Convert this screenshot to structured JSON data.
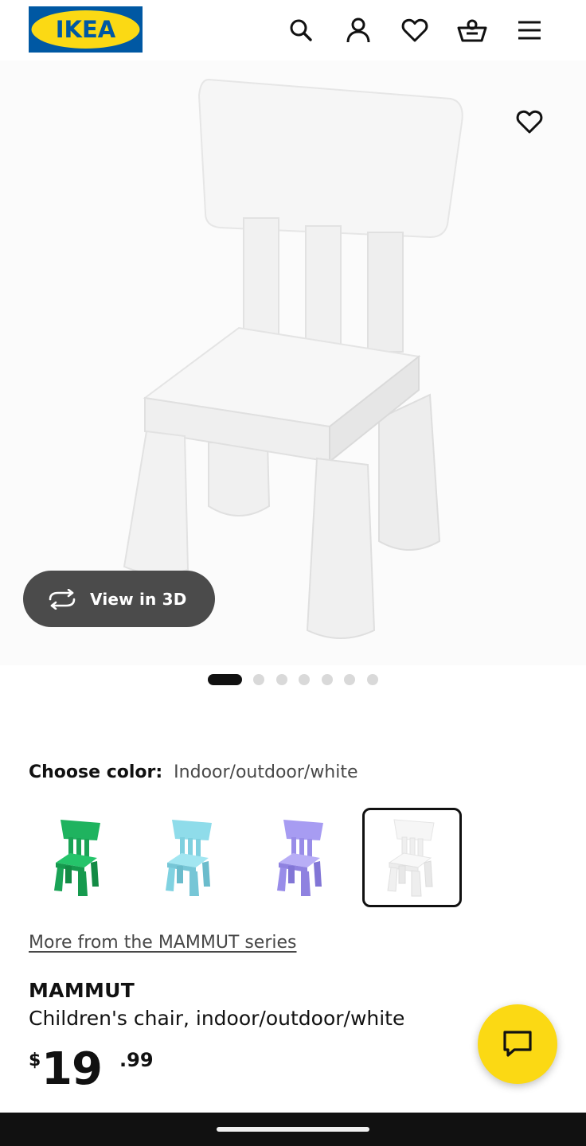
{
  "header": {
    "logo_text": "IKEA",
    "icons": [
      "search-icon",
      "account-icon",
      "favorites-icon",
      "cart-icon",
      "menu-icon"
    ]
  },
  "colors": {
    "ikea_blue": "#0058a3",
    "ikea_yellow": "#fbd914",
    "text_dark": "#111111",
    "text_muted": "#484848",
    "view3d_bg": "#4b4b4b",
    "navbar": "#111111"
  },
  "hero": {
    "view3d_label": "View in 3D",
    "carousel": {
      "total": 7,
      "active_index": 0
    }
  },
  "color_chooser": {
    "label": "Choose color:",
    "selected_value": "Indoor/outdoor/white",
    "options": [
      {
        "name": "green",
        "color": "#1fb35f"
      },
      {
        "name": "light blue",
        "color": "#8fdcea"
      },
      {
        "name": "lilac",
        "color": "#a79cf2"
      },
      {
        "name": "white",
        "color": "#f3f3f3",
        "selected": true
      }
    ]
  },
  "series_link": "More from the MAMMUT series",
  "product": {
    "name": "MAMMUT",
    "description": "Children's chair, indoor/outdoor/white",
    "price": {
      "currency": "$",
      "integer": "19",
      "decimal": ".99"
    }
  },
  "chat": {
    "icon": "chat-icon"
  }
}
